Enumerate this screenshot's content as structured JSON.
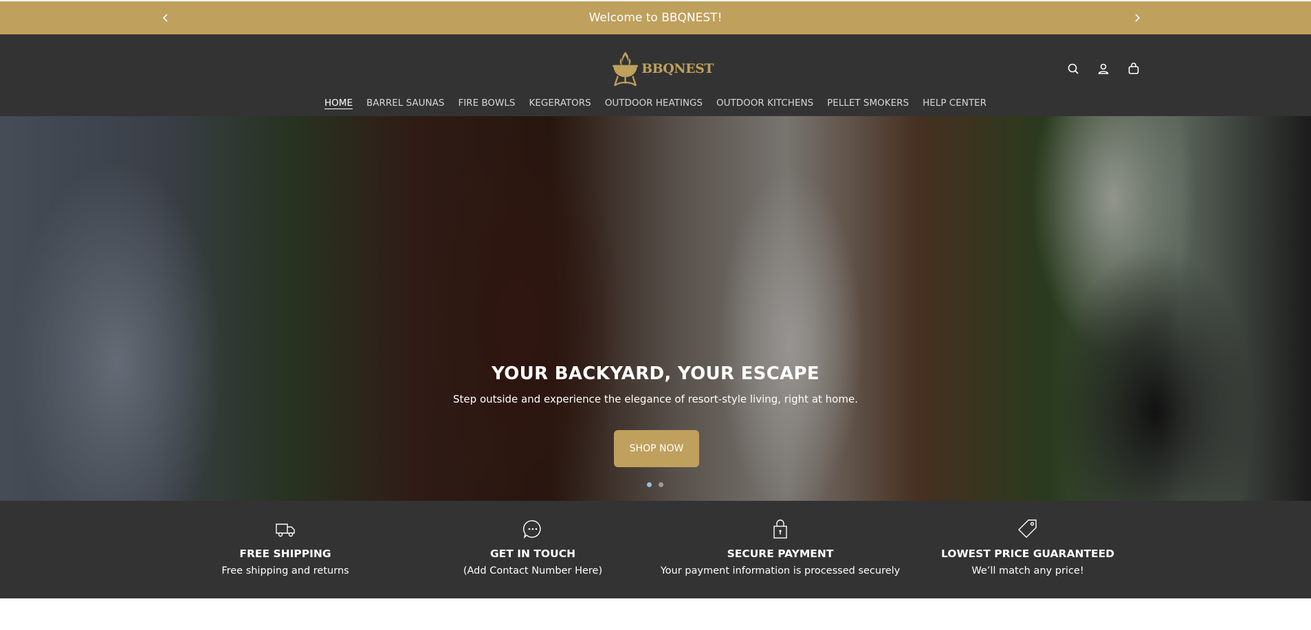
{
  "announcement": {
    "message": "Welcome to BBQNEST!",
    "prev_icon": "chevron-left-icon",
    "next_icon": "chevron-right-icon"
  },
  "header": {
    "brand": "BBQNEST",
    "icons": [
      "search-icon",
      "account-icon",
      "cart-icon"
    ]
  },
  "nav": {
    "items": [
      {
        "label": "HOME",
        "active": true
      },
      {
        "label": "BARREL SAUNAS"
      },
      {
        "label": "FIRE BOWLS"
      },
      {
        "label": "KEGERATORS"
      },
      {
        "label": "OUTDOOR HEATINGS"
      },
      {
        "label": "OUTDOOR KITCHENS"
      },
      {
        "label": "PELLET SMOKERS"
      },
      {
        "label": "HELP CENTER"
      }
    ]
  },
  "hero": {
    "title": "YOUR BACKYARD, YOUR ESCAPE",
    "subtitle": "Step outside and experience the elegance of resort-style living, right at home.",
    "cta_label": "SHOP NOW",
    "slide_count": 2,
    "active_slide": 1
  },
  "features": [
    {
      "icon": "truck-icon",
      "title": "FREE SHIPPING",
      "desc": "Free shipping and returns"
    },
    {
      "icon": "chat-icon",
      "title": "GET IN TOUCH",
      "desc": "(Add Contact Number Here)"
    },
    {
      "icon": "lock-icon",
      "title": "SECURE PAYMENT",
      "desc": "Your payment information is processed securely"
    },
    {
      "icon": "tag-icon",
      "title": "LOWEST PRICE GUARANTEED",
      "desc": "We’ll match any price!"
    }
  ],
  "colors": {
    "accent": "#bfa05d",
    "dark": "#333333"
  }
}
